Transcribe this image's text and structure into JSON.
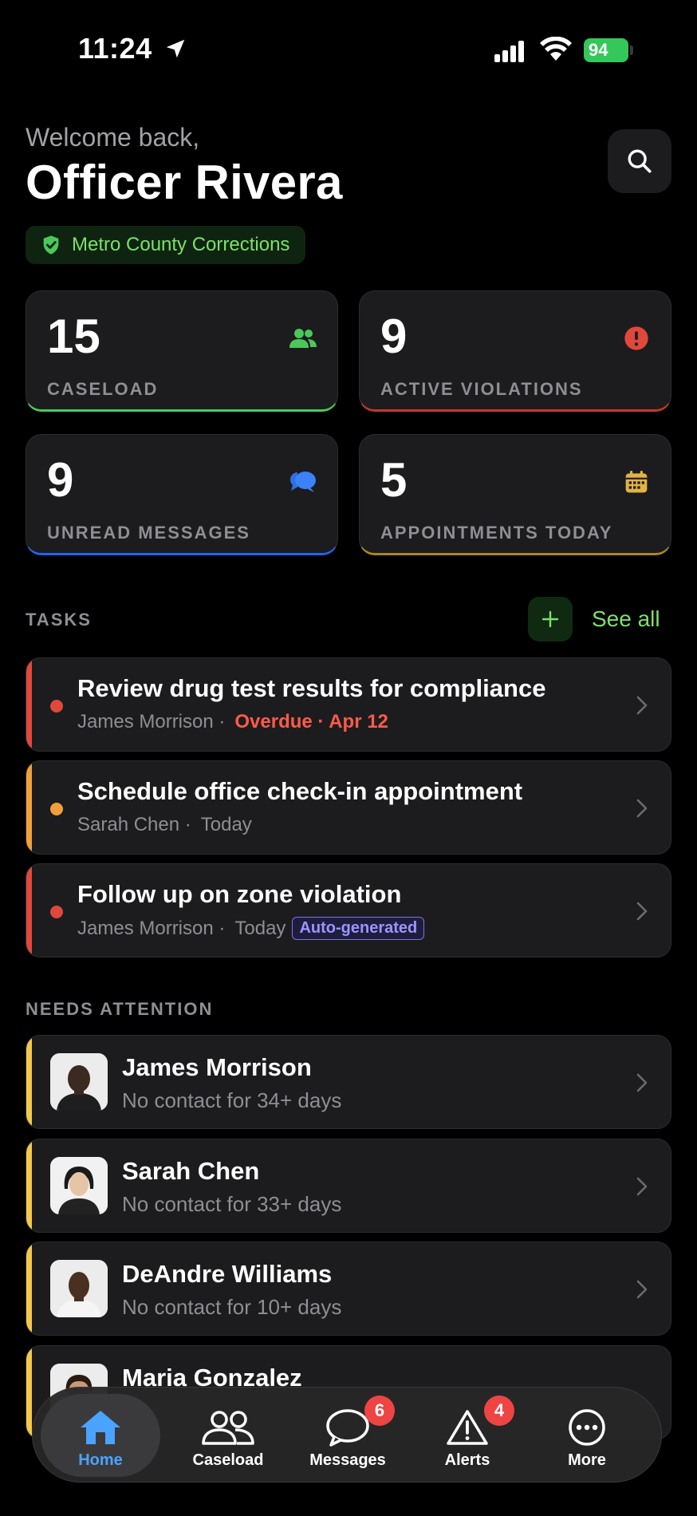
{
  "status_bar": {
    "time": "11:24",
    "battery": "94"
  },
  "header": {
    "welcome": "Welcome back,",
    "officer_name": "Officer Rivera",
    "organization": "Metro County Corrections"
  },
  "stats": [
    {
      "value": "15",
      "label": "CASELOAD",
      "icon": "people-icon",
      "color": "#4cc75a"
    },
    {
      "value": "9",
      "label": "ACTIVE VIOLATIONS",
      "icon": "alert-circle-icon",
      "color": "#e0483c"
    },
    {
      "value": "9",
      "label": "UNREAD MESSAGES",
      "icon": "chat-bubbles-icon",
      "color": "#3b82f6"
    },
    {
      "value": "5",
      "label": "APPOINTMENTS TODAY",
      "icon": "calendar-icon",
      "color": "#d4a93a"
    }
  ],
  "tasks_section": {
    "label": "TASKS",
    "see_all": "See all"
  },
  "tasks": [
    {
      "title": "Review drug test results for compliance",
      "person": "James Morrison",
      "separator": "·",
      "status": "Overdue · Apr 12",
      "priority_color": "#e0483c"
    },
    {
      "title": "Schedule office check-in appointment",
      "person": "Sarah Chen",
      "separator": "·",
      "due": "Today",
      "priority_color": "#f0a03a"
    },
    {
      "title": "Follow up on zone violation",
      "person": "James Morrison",
      "separator": "·",
      "due": "Today",
      "tag": "Auto-generated",
      "priority_color": "#e0483c"
    }
  ],
  "attention_section": {
    "label": "NEEDS ATTENTION"
  },
  "attention": [
    {
      "name": "James Morrison",
      "detail": "No contact for 34+ days"
    },
    {
      "name": "Sarah Chen",
      "detail": "No contact for 33+ days"
    },
    {
      "name": "DeAndre Williams",
      "detail": "No contact for 10+ days"
    },
    {
      "name": "Maria Gonzalez",
      "detail": ""
    }
  ],
  "tabbar": {
    "home": "Home",
    "caseload": "Caseload",
    "messages": "Messages",
    "messages_badge": "6",
    "alerts": "Alerts",
    "alerts_badge": "4",
    "more": "More"
  },
  "colors": {
    "accent_green": "#7ce06a",
    "active_tab": "#4aa3ff",
    "attention_stripe": "#f2c94c"
  }
}
